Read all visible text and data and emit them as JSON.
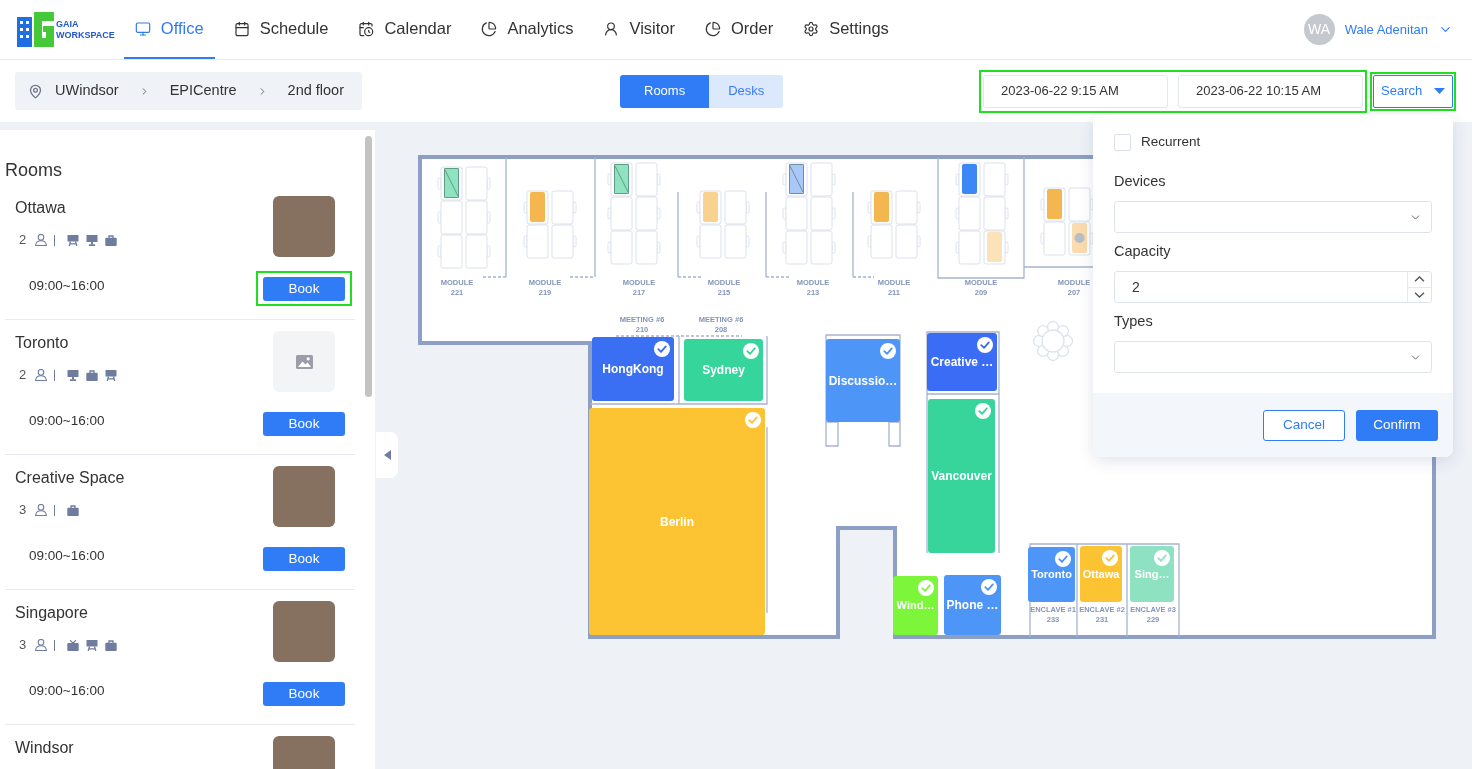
{
  "nav": {
    "logo": {
      "line_1": "GAIA",
      "line_2": "WORKSPACE"
    },
    "items": [
      {
        "label": "Office",
        "selected": true
      },
      {
        "label": "Schedule",
        "selected": false
      },
      {
        "label": "Calendar",
        "selected": false
      },
      {
        "label": "Analytics",
        "selected": false
      },
      {
        "label": "Visitor",
        "selected": false
      },
      {
        "label": "Order",
        "selected": false
      },
      {
        "label": "Settings",
        "selected": false
      }
    ]
  },
  "user": {
    "initials": "WA",
    "name": "Wale Adenitan"
  },
  "location_bar": {
    "breadcrumb": [
      "UWindsor",
      "EPICentre",
      "2nd floor"
    ],
    "view_toggle": [
      {
        "label": "Rooms",
        "selected": true
      },
      {
        "label": "Desks",
        "selected": false
      }
    ],
    "time_range": {
      "start": "2023-06-22 9:15 AM",
      "end": "2023-06-22 10:15 AM",
      "highlighted": true
    },
    "search": {
      "label": "Search",
      "highlighted": true,
      "expanded": true
    }
  },
  "filter_panel": {
    "recurrent": {
      "label": "Recurrent",
      "checked": false
    },
    "fields": [
      {
        "label": "Devices",
        "kind": "select"
      },
      {
        "label": "Capacity",
        "kind": "number",
        "value": "2"
      },
      {
        "label": "Types",
        "kind": "select"
      }
    ],
    "buttons": [
      {
        "label": "Cancel",
        "kind": "secondary"
      },
      {
        "label": "Confirm",
        "kind": "primary"
      }
    ]
  },
  "sidebar": {
    "title": "Rooms",
    "rooms": [
      {
        "name": "Ottawa",
        "capacity": "2",
        "devices": [
          {
            "kind": "stand"
          },
          {
            "kind": "monitor"
          },
          {
            "kind": "briefcase"
          }
        ],
        "has_photo": true,
        "hours": "09:00~16:00",
        "book": {
          "label": "Book",
          "highlighted": true
        }
      },
      {
        "name": "Toronto",
        "capacity": "2",
        "devices": [
          {
            "kind": "monitor"
          },
          {
            "kind": "briefcase"
          },
          {
            "kind": "stand"
          }
        ],
        "has_photo": false,
        "hours": "09:00~16:00",
        "book": {
          "label": "Book",
          "highlighted": false
        }
      },
      {
        "name": "Creative Space",
        "capacity": "3",
        "devices": [
          {
            "kind": "briefcase"
          }
        ],
        "has_photo": true,
        "hours": "09:00~16:00",
        "book": {
          "label": "Book",
          "highlighted": false
        }
      },
      {
        "name": "Singapore",
        "capacity": "3",
        "devices": [
          {
            "kind": "tv"
          },
          {
            "kind": "stand"
          },
          {
            "kind": "briefcase"
          }
        ],
        "has_photo": true,
        "hours": "09:00~16:00",
        "book": {
          "label": "Book",
          "highlighted": false
        }
      },
      {
        "name": "Windsor",
        "has_photo": true
      }
    ]
  },
  "floor_plan": {
    "modules": [
      {
        "label": "MODULE",
        "number": "221",
        "desks": [
          {
            "booked": true,
            "color": "#8fe3c0",
            "hatched": true,
            "avatar": false
          },
          {
            "booked": false
          },
          {
            "booked": false
          },
          {
            "booked": false
          },
          {
            "booked": false
          },
          {
            "booked": false
          }
        ]
      },
      {
        "label": "MODULE",
        "number": "219",
        "desks": [
          {
            "booked": true,
            "color": "#f4b64e",
            "hatched": false,
            "avatar": false
          },
          {
            "booked": false
          },
          {
            "booked": false
          },
          {
            "booked": false
          }
        ]
      },
      {
        "label": "MODULE",
        "number": "217",
        "desks": [
          {
            "booked": true,
            "color": "#8fe3c0",
            "hatched": true,
            "avatar": false
          },
          {
            "booked": false
          },
          {
            "booked": false
          },
          {
            "booked": false
          },
          {
            "booked": false
          },
          {
            "booked": false
          }
        ]
      },
      {
        "label": "MODULE",
        "number": "215",
        "desks": [
          {
            "booked": true,
            "color": "#f8d28f",
            "hatched": false,
            "avatar": false
          },
          {
            "booked": false
          },
          {
            "booked": false
          },
          {
            "booked": false
          }
        ]
      },
      {
        "label": "MODULE",
        "number": "213",
        "desks": [
          {
            "booked": true,
            "color": "#a9c7f7",
            "hatched": true,
            "avatar": false
          },
          {
            "booked": false
          },
          {
            "booked": false
          },
          {
            "booked": false
          },
          {
            "booked": false
          },
          {
            "booked": false
          }
        ]
      },
      {
        "label": "MODULE",
        "number": "211",
        "desks": [
          {
            "booked": true,
            "color": "#f4b64e",
            "hatched": false,
            "avatar": false
          },
          {
            "booked": false
          },
          {
            "booked": false
          },
          {
            "booked": false
          }
        ]
      },
      {
        "label": "MODULE",
        "number": "209",
        "desks": [
          {
            "booked": true,
            "color": "#3d86f6",
            "hatched": false,
            "avatar": false
          },
          {
            "booked": false
          },
          {
            "booked": false
          },
          {
            "booked": false
          },
          {
            "booked": false
          },
          {
            "booked": true,
            "color": "#fbe2b8",
            "hatched": false,
            "avatar": false
          }
        ]
      },
      {
        "label": "MODULE",
        "number": "207",
        "desks": [
          {
            "booked": true,
            "color": "#f4b64e",
            "hatched": false,
            "avatar": false
          },
          {
            "booked": false
          },
          {
            "booked": false
          },
          {
            "booked": true,
            "color": "#fbdcae",
            "hatched": false,
            "avatar": true
          }
        ]
      }
    ],
    "meeting_labels": [
      {
        "label": "MEETING #6",
        "number": "210"
      },
      {
        "label": "MEETING #6",
        "number": "208"
      }
    ],
    "rooms": [
      {
        "name": "HongKong",
        "color": "#3b6ff3",
        "checked": true
      },
      {
        "name": "Sydney",
        "color": "#36d59b",
        "checked": true
      },
      {
        "name": "Berlin",
        "color": "#fcc433",
        "checked": true
      },
      {
        "name": "Discussio…",
        "color": "#4e95f8",
        "checked": true
      },
      {
        "name": "Creative …",
        "color": "#3a6cf5",
        "checked": true
      },
      {
        "name": "Vancouver",
        "color": "#37d49b",
        "checked": true
      },
      {
        "name": "Wind…",
        "color": "#7cf53b",
        "checked": true
      },
      {
        "name": "Phone …",
        "color": "#4e95f8",
        "checked": true
      },
      {
        "name": "Toronto",
        "color": "#4e95f8",
        "checked": true
      },
      {
        "name": "Ottawa",
        "color": "#fcc433",
        "checked": true
      },
      {
        "name": "Sing…",
        "color": "#8fe2c1",
        "checked": true
      }
    ],
    "enclave_labels": [
      {
        "label": "ENCLAVE #1",
        "number": "233"
      },
      {
        "label": "ENCLAVE #2",
        "number": "231"
      },
      {
        "label": "ENCLAVE #3",
        "number": "229"
      }
    ]
  }
}
